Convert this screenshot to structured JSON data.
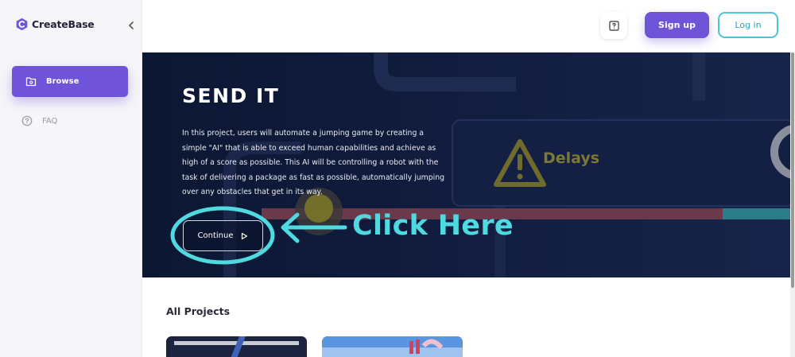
{
  "app": {
    "name": "CreateBase"
  },
  "sidebar": {
    "items": [
      {
        "label": "Browse",
        "icon": "folder-icon",
        "active": true
      },
      {
        "label": "FAQ",
        "icon": "question-circle-icon",
        "active": false
      }
    ]
  },
  "header": {
    "signup_label": "Sign up",
    "login_label": "Log in",
    "help_icon": "question-square-icon"
  },
  "hero": {
    "title": "SEND IT",
    "description": "In this project, users will automate a jumping game by creating a simple \"AI\" that is able to exceed human capabilities and achieve as high of a score as possible. This AI will be controlling a robot with the task of delivering a package as fast as possible, automatically jumping over any obstacles that get in its way.",
    "continue_label": "Continue",
    "background_sign": "Delays",
    "annotation": "Click Here"
  },
  "projects": {
    "section_title": "All Projects"
  },
  "colors": {
    "accent": "#6f53d9",
    "login_border": "#4cc3d6",
    "annotation": "#4fd9e0",
    "hero_bg": "#0c1733"
  }
}
